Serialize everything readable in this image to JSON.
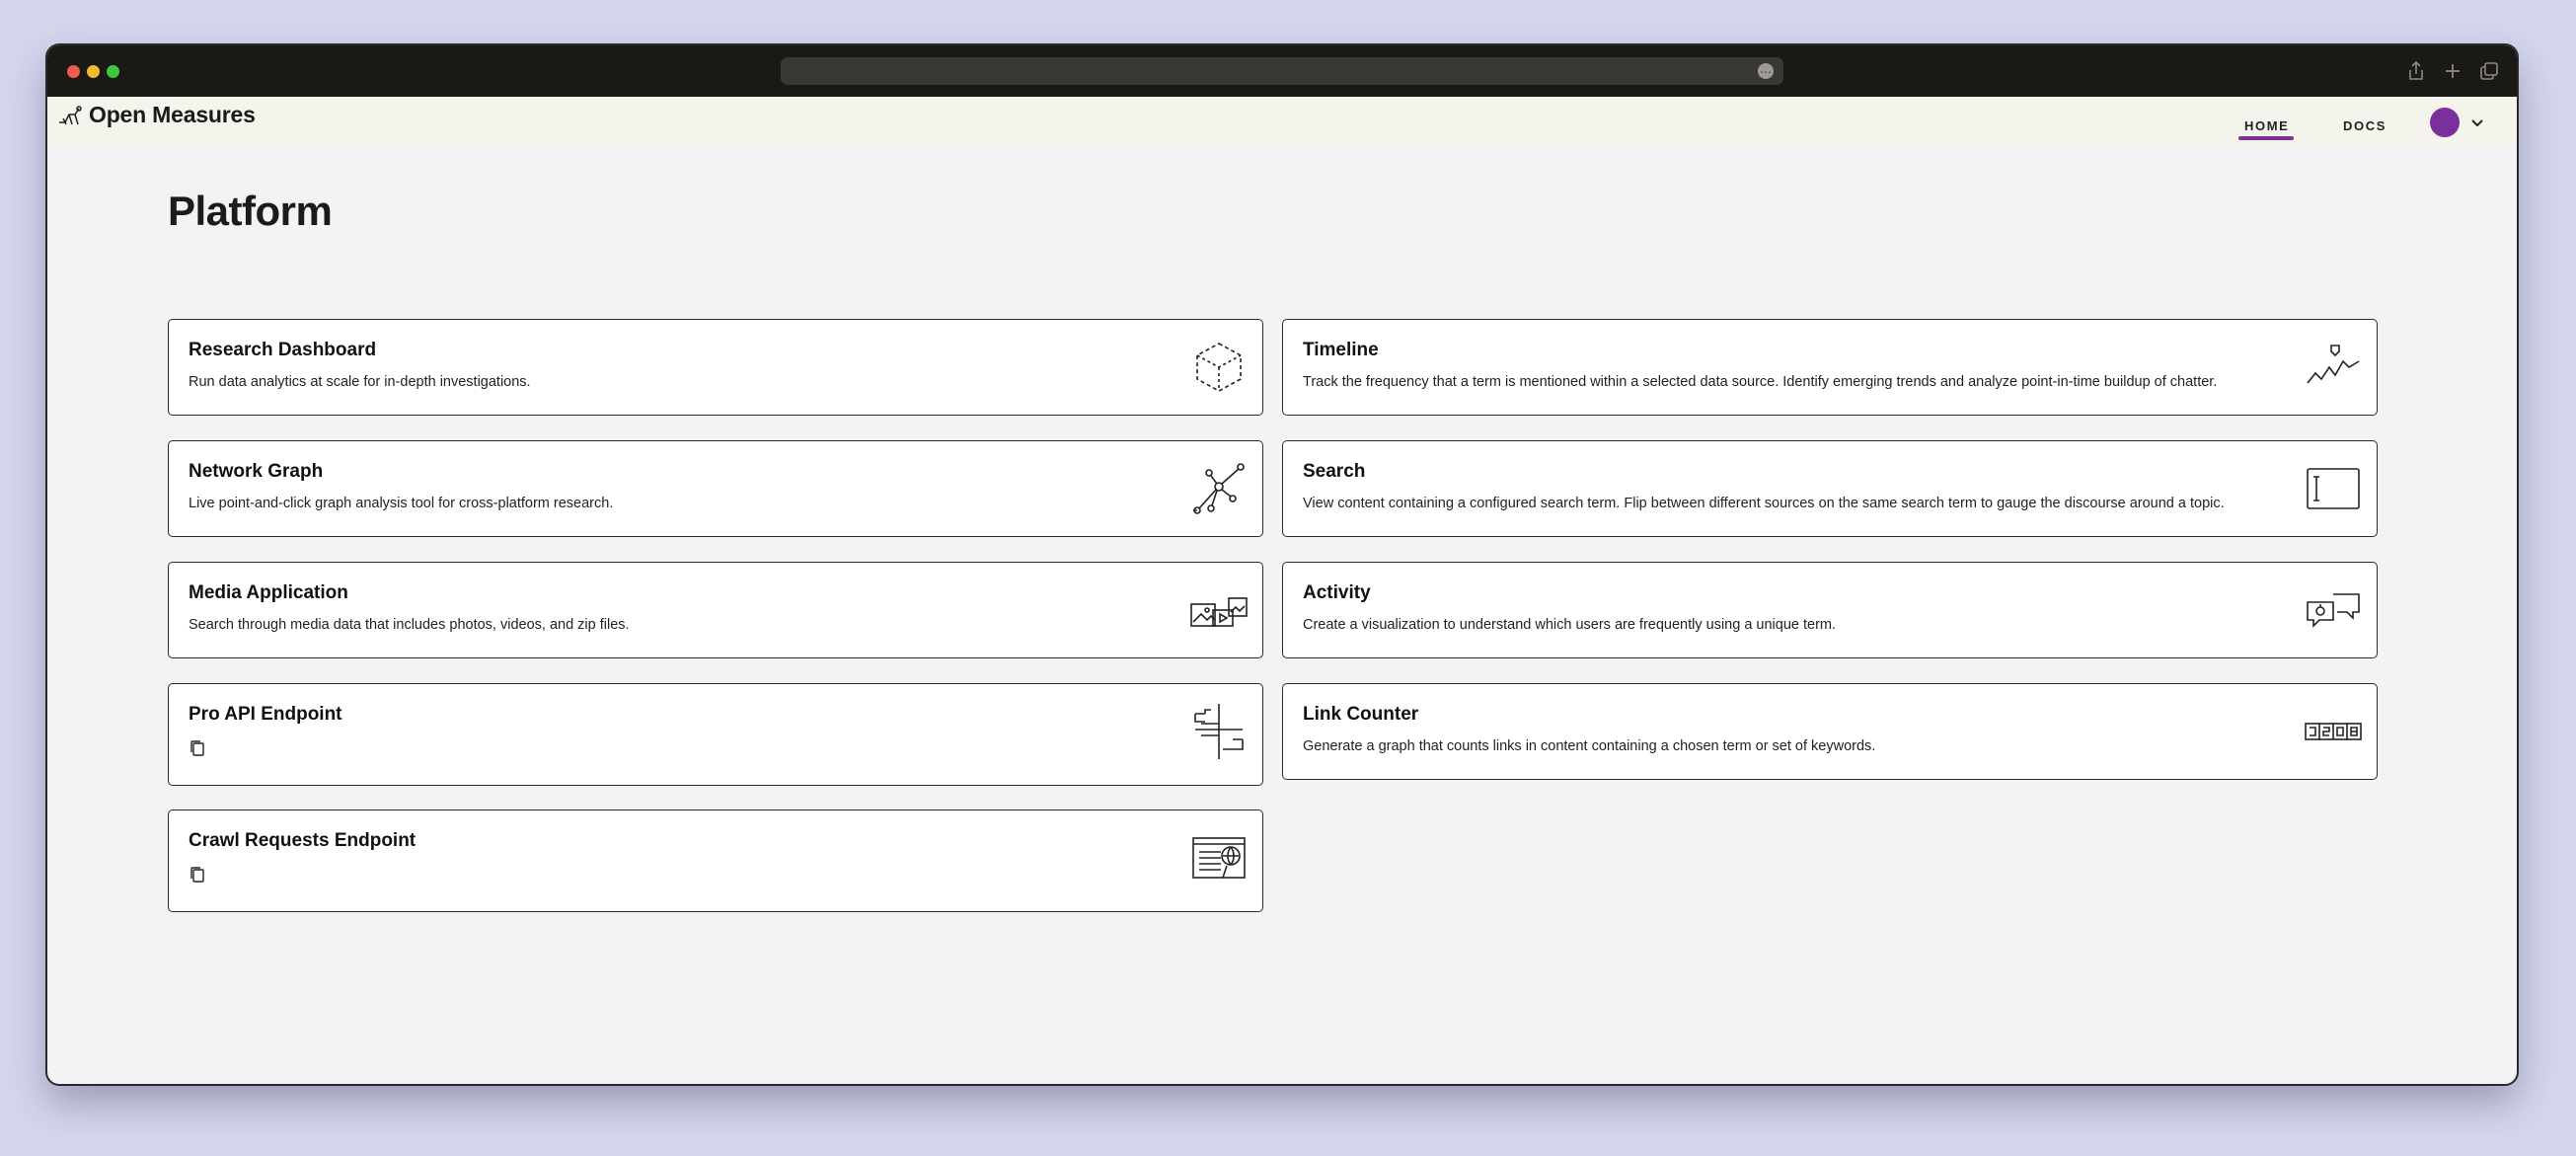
{
  "app": {
    "brand": "Open Measures"
  },
  "nav": {
    "home": "HOME",
    "docs": "DOCS"
  },
  "page": {
    "title": "Platform"
  },
  "cards": [
    {
      "title": "Research Dashboard",
      "description": "Run data analytics at scale for in-depth investigations.",
      "icon": "cube-icon"
    },
    {
      "title": "Timeline",
      "description": "Track the frequency that a term is mentioned within a selected data source. Identify emerging trends and analyze point-in-time buildup of chatter.",
      "icon": "trend-line-icon"
    },
    {
      "title": "Network Graph",
      "description": "Live point-and-click graph analysis tool for cross-platform research.",
      "icon": "network-graph-icon"
    },
    {
      "title": "Search",
      "description": "View content containing a configured search term. Flip between different sources on the same search term to gauge the discourse around a topic.",
      "icon": "text-cursor-box-icon"
    },
    {
      "title": "Media Application",
      "description": "Search through media data that includes photos, videos, and zip files.",
      "icon": "media-stack-icon"
    },
    {
      "title": "Activity",
      "description": "Create a visualization to understand which users are frequently using a unique term.",
      "icon": "chat-bubbles-icon"
    },
    {
      "title": "Pro API Endpoint",
      "description": "",
      "icon": "api-endpoint-icon",
      "has_copy": true
    },
    {
      "title": "Link Counter",
      "description": "Generate a graph that counts links in content containing a chosen term or set of keywords.",
      "icon": "counter-icon"
    },
    {
      "title": "Crawl Requests Endpoint",
      "description": "",
      "icon": "crawl-document-icon",
      "has_copy": true
    }
  ],
  "colors": {
    "accent": "#7b2f9c",
    "page_background": "#f3f3f6",
    "card_border": "#2b2b2b",
    "outer_background": "#d4d6ee"
  }
}
